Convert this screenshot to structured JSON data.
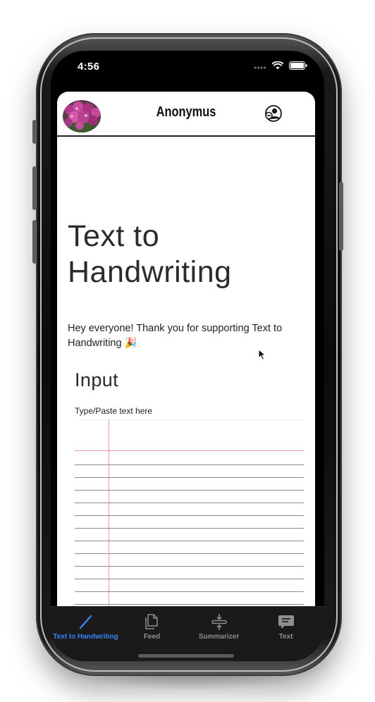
{
  "status_bar": {
    "time": "4:56"
  },
  "header": {
    "title": "Anonymus"
  },
  "main": {
    "title": "Text to Handwriting",
    "intro": "Hey everyone! Thank you for supporting Text to Handwriting 🎉",
    "input_section": {
      "heading": "Input",
      "label": "Type/Paste text here",
      "value": ""
    }
  },
  "tabs": [
    {
      "label": "Text to Handwriting",
      "icon": "pen-icon",
      "active": true
    },
    {
      "label": "Feed",
      "icon": "documents-icon",
      "active": false
    },
    {
      "label": "Summarizer",
      "icon": "compress-icon",
      "active": false
    },
    {
      "label": "Text",
      "icon": "chat-bubble-icon",
      "active": false
    }
  ],
  "colors": {
    "accent": "#3b82f6",
    "tab_inactive": "#8e8e93",
    "margin_line": "#e79aa2",
    "rule_line": "#8c8c8c"
  }
}
